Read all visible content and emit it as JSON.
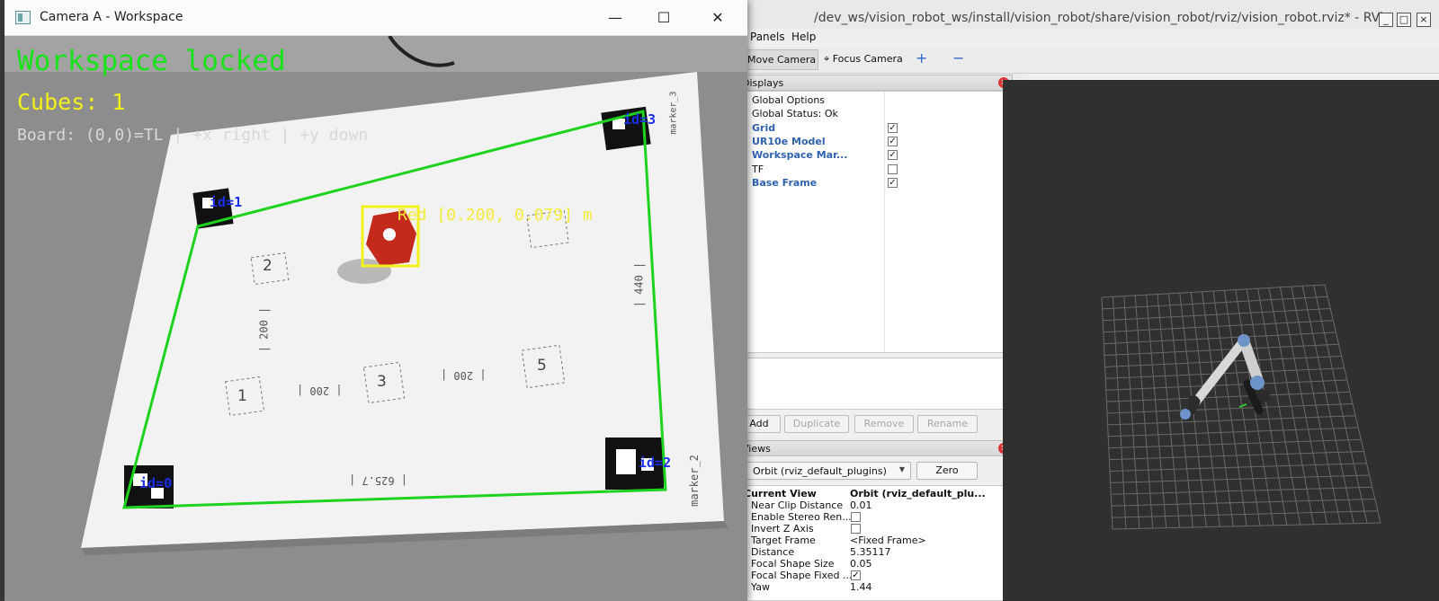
{
  "camera_window": {
    "title": "Camera A - Workspace",
    "controls": {
      "minimize": "—",
      "maximize": "☐",
      "close": "✕"
    },
    "overlay": {
      "status": "Workspace locked",
      "cubes": "Cubes: 1",
      "board": "Board: (0,0)=TL | +x right | +y down",
      "cube_label": "Red [0.200, 0.079] m",
      "markers": [
        "id=0",
        "id=1",
        "id=2",
        "id=3"
      ]
    },
    "paper": {
      "cells": [
        "1",
        "2",
        "3",
        "5"
      ],
      "labels": [
        "| 440 |",
        "| 200 |",
        "| 200 |",
        "| 200 |",
        "| 625.7 |",
        "marker_2",
        "marker_3"
      ]
    },
    "colors": {
      "workspace_outline": "#1ed31e",
      "cube": "#c42a1c",
      "cube_box": "#f2f21a",
      "marker_label": "#1b2fe8"
    }
  },
  "rviz_window": {
    "title": "/dev_ws/vision_robot_ws/install/vision_robot/share/vision_robot/rviz/vision_robot.rviz* - RViz",
    "menu": [
      "Panels",
      "Help"
    ],
    "toolbar": {
      "move_camera": "Move Camera",
      "focus_camera": "Focus Camera",
      "plus_icon": "+",
      "minus_icon": "−"
    },
    "displays_panel": {
      "title": "Displays",
      "items": [
        {
          "label": "Global Options",
          "checkbox": null
        },
        {
          "label": "Global Status: Ok",
          "checkbox": null
        },
        {
          "label": "Grid",
          "checkbox": "✓"
        },
        {
          "label": "UR10e Model",
          "checkbox": "✓"
        },
        {
          "label": "Workspace Mar...",
          "checkbox": "✓"
        },
        {
          "label": "TF",
          "checkbox": ""
        },
        {
          "label": "Base Frame",
          "checkbox": "✓"
        }
      ],
      "buttons": [
        "Add",
        "Duplicate",
        "Remove",
        "Rename"
      ]
    },
    "views_panel": {
      "title": "Views",
      "type_select": "Orbit (rviz_default_plugins)",
      "zero_button": "Zero",
      "properties": [
        {
          "key": "Current View",
          "value": "Orbit (rviz_default_plu..."
        },
        {
          "key": "Near Clip Distance",
          "value": "0.01"
        },
        {
          "key": "Enable Stereo Ren...",
          "value": ""
        },
        {
          "key": "Invert Z Axis",
          "value": ""
        },
        {
          "key": "Target Frame",
          "value": "<Fixed Frame>"
        },
        {
          "key": "Distance",
          "value": "5.35117"
        },
        {
          "key": "Focal Shape Size",
          "value": "0.05"
        },
        {
          "key": "Focal Shape Fixed ...",
          "value": "✓"
        },
        {
          "key": "Yaw",
          "value": "1.44"
        }
      ]
    },
    "viewport": {
      "background": "#303030",
      "grid": "#6a6a6a",
      "robot": "#d8d8d8",
      "joint": "#6e93c9"
    }
  }
}
